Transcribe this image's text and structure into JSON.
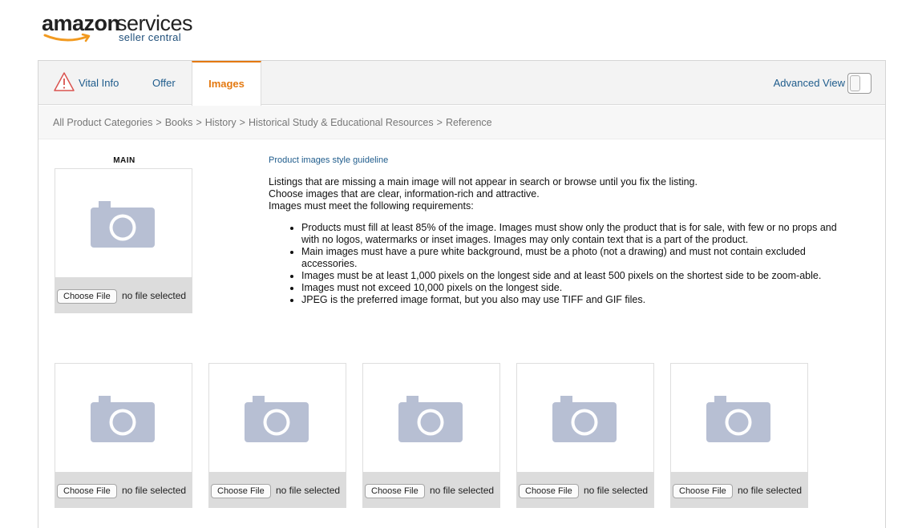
{
  "logo": {
    "brand": "amazon",
    "product": "services",
    "subtitle": "seller central"
  },
  "tabs": {
    "vital_info": "Vital Info",
    "offer": "Offer",
    "images": "Images",
    "active": "Images",
    "warning_icon": "warning-triangle-icon"
  },
  "advanced_view": {
    "label": "Advanced View",
    "on": false
  },
  "breadcrumb": [
    "All Product Categories",
    "Books",
    "History",
    "Historical Study & Educational Resources",
    "Reference"
  ],
  "main_slot": {
    "label": "MAIN",
    "button": "Choose File",
    "status": "no file selected"
  },
  "guideline_link": "Product images style guideline",
  "intro_lines": [
    "Listings that are missing a main image will not appear in search or browse until you fix the listing.",
    "Choose images that are clear, information-rich and attractive.",
    "Images must meet the following requirements:"
  ],
  "requirements": [
    "Products must fill at least 85% of the image. Images must show only the product that is for sale, with few or no props and with no logos, watermarks or inset images. Images may only contain text that is a part of the product.",
    "Main images must have a pure white background, must be a photo (not a drawing) and must not contain excluded accessories.",
    "Images must be at least 1,000 pixels on the longest side and at least 500 pixels on the shortest side to be zoom-able.",
    "Images must not exceed 10,000 pixels on the longest side.",
    "JPEG is the preferred image format, but you also may use TIFF and GIF files."
  ],
  "extra_slots": [
    {
      "button": "Choose File",
      "status": "no file selected"
    },
    {
      "button": "Choose File",
      "status": "no file selected"
    },
    {
      "button": "Choose File",
      "status": "no file selected"
    },
    {
      "button": "Choose File",
      "status": "no file selected"
    },
    {
      "button": "Choose File",
      "status": "no file selected"
    }
  ],
  "colors": {
    "accent": "#e47911",
    "link": "#1f5c8c",
    "camera": "#b7bfd3"
  }
}
